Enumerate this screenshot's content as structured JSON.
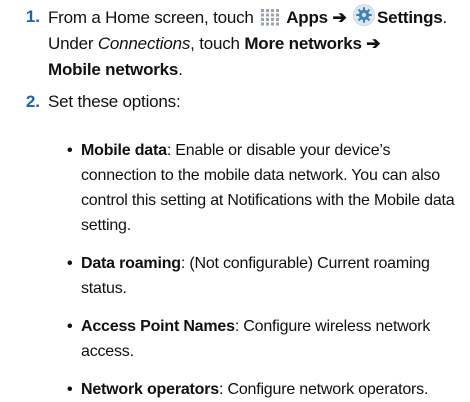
{
  "steps": [
    {
      "number": "1.",
      "text_prefix": "From a Home screen, touch",
      "apps_icon": "apps-grid-icon",
      "apps_label": "Apps",
      "arrow_1": "➔",
      "settings_icon": "gear-icon",
      "settings_label": "Settings",
      "period": ".",
      "under_prefix": "Under",
      "connections_label": "Connections",
      "under_suffix": ", touch",
      "more_networks_label": "More networks",
      "arrow_2": "➔",
      "mobile_networks_label": "Mobile networks",
      "end_period": "."
    },
    {
      "number": "2.",
      "text": "Set these options:"
    }
  ],
  "options": [
    {
      "term": "Mobile data",
      "description": ": Enable or disable your device’s connection to the mobile data network. You can also control this setting at Notifications with the Mobile data setting."
    },
    {
      "term": "Data roaming",
      "description": ": (Not configurable) Current roaming status."
    },
    {
      "term": "Access Point Names",
      "description": ": Configure wireless network access."
    },
    {
      "term": "Network operators",
      "description": ": Configure network operators."
    }
  ],
  "bullet_char": "•",
  "colors": {
    "step_number": "#1565c0",
    "icon_blue": "#3b82c4",
    "icon_grid": "#9aa3ad"
  }
}
